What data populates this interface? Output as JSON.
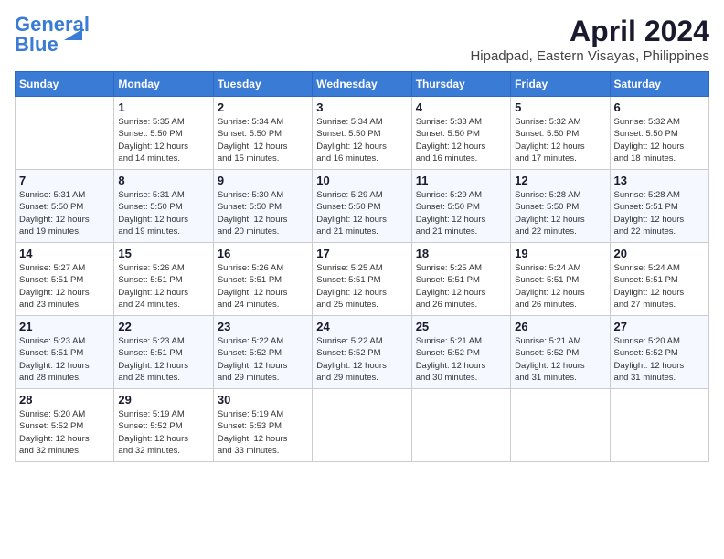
{
  "logo": {
    "general": "General",
    "blue": "Blue"
  },
  "title": "April 2024",
  "location": "Hipadpad, Eastern Visayas, Philippines",
  "days_of_week": [
    "Sunday",
    "Monday",
    "Tuesday",
    "Wednesday",
    "Thursday",
    "Friday",
    "Saturday"
  ],
  "weeks": [
    [
      {
        "day": "",
        "info": ""
      },
      {
        "day": "1",
        "info": "Sunrise: 5:35 AM\nSunset: 5:50 PM\nDaylight: 12 hours\nand 14 minutes."
      },
      {
        "day": "2",
        "info": "Sunrise: 5:34 AM\nSunset: 5:50 PM\nDaylight: 12 hours\nand 15 minutes."
      },
      {
        "day": "3",
        "info": "Sunrise: 5:34 AM\nSunset: 5:50 PM\nDaylight: 12 hours\nand 16 minutes."
      },
      {
        "day": "4",
        "info": "Sunrise: 5:33 AM\nSunset: 5:50 PM\nDaylight: 12 hours\nand 16 minutes."
      },
      {
        "day": "5",
        "info": "Sunrise: 5:32 AM\nSunset: 5:50 PM\nDaylight: 12 hours\nand 17 minutes."
      },
      {
        "day": "6",
        "info": "Sunrise: 5:32 AM\nSunset: 5:50 PM\nDaylight: 12 hours\nand 18 minutes."
      }
    ],
    [
      {
        "day": "7",
        "info": "Sunrise: 5:31 AM\nSunset: 5:50 PM\nDaylight: 12 hours\nand 19 minutes."
      },
      {
        "day": "8",
        "info": "Sunrise: 5:31 AM\nSunset: 5:50 PM\nDaylight: 12 hours\nand 19 minutes."
      },
      {
        "day": "9",
        "info": "Sunrise: 5:30 AM\nSunset: 5:50 PM\nDaylight: 12 hours\nand 20 minutes."
      },
      {
        "day": "10",
        "info": "Sunrise: 5:29 AM\nSunset: 5:50 PM\nDaylight: 12 hours\nand 21 minutes."
      },
      {
        "day": "11",
        "info": "Sunrise: 5:29 AM\nSunset: 5:50 PM\nDaylight: 12 hours\nand 21 minutes."
      },
      {
        "day": "12",
        "info": "Sunrise: 5:28 AM\nSunset: 5:50 PM\nDaylight: 12 hours\nand 22 minutes."
      },
      {
        "day": "13",
        "info": "Sunrise: 5:28 AM\nSunset: 5:51 PM\nDaylight: 12 hours\nand 22 minutes."
      }
    ],
    [
      {
        "day": "14",
        "info": "Sunrise: 5:27 AM\nSunset: 5:51 PM\nDaylight: 12 hours\nand 23 minutes."
      },
      {
        "day": "15",
        "info": "Sunrise: 5:26 AM\nSunset: 5:51 PM\nDaylight: 12 hours\nand 24 minutes."
      },
      {
        "day": "16",
        "info": "Sunrise: 5:26 AM\nSunset: 5:51 PM\nDaylight: 12 hours\nand 24 minutes."
      },
      {
        "day": "17",
        "info": "Sunrise: 5:25 AM\nSunset: 5:51 PM\nDaylight: 12 hours\nand 25 minutes."
      },
      {
        "day": "18",
        "info": "Sunrise: 5:25 AM\nSunset: 5:51 PM\nDaylight: 12 hours\nand 26 minutes."
      },
      {
        "day": "19",
        "info": "Sunrise: 5:24 AM\nSunset: 5:51 PM\nDaylight: 12 hours\nand 26 minutes."
      },
      {
        "day": "20",
        "info": "Sunrise: 5:24 AM\nSunset: 5:51 PM\nDaylight: 12 hours\nand 27 minutes."
      }
    ],
    [
      {
        "day": "21",
        "info": "Sunrise: 5:23 AM\nSunset: 5:51 PM\nDaylight: 12 hours\nand 28 minutes."
      },
      {
        "day": "22",
        "info": "Sunrise: 5:23 AM\nSunset: 5:51 PM\nDaylight: 12 hours\nand 28 minutes."
      },
      {
        "day": "23",
        "info": "Sunrise: 5:22 AM\nSunset: 5:52 PM\nDaylight: 12 hours\nand 29 minutes."
      },
      {
        "day": "24",
        "info": "Sunrise: 5:22 AM\nSunset: 5:52 PM\nDaylight: 12 hours\nand 29 minutes."
      },
      {
        "day": "25",
        "info": "Sunrise: 5:21 AM\nSunset: 5:52 PM\nDaylight: 12 hours\nand 30 minutes."
      },
      {
        "day": "26",
        "info": "Sunrise: 5:21 AM\nSunset: 5:52 PM\nDaylight: 12 hours\nand 31 minutes."
      },
      {
        "day": "27",
        "info": "Sunrise: 5:20 AM\nSunset: 5:52 PM\nDaylight: 12 hours\nand 31 minutes."
      }
    ],
    [
      {
        "day": "28",
        "info": "Sunrise: 5:20 AM\nSunset: 5:52 PM\nDaylight: 12 hours\nand 32 minutes."
      },
      {
        "day": "29",
        "info": "Sunrise: 5:19 AM\nSunset: 5:52 PM\nDaylight: 12 hours\nand 32 minutes."
      },
      {
        "day": "30",
        "info": "Sunrise: 5:19 AM\nSunset: 5:53 PM\nDaylight: 12 hours\nand 33 minutes."
      },
      {
        "day": "",
        "info": ""
      },
      {
        "day": "",
        "info": ""
      },
      {
        "day": "",
        "info": ""
      },
      {
        "day": "",
        "info": ""
      }
    ]
  ]
}
